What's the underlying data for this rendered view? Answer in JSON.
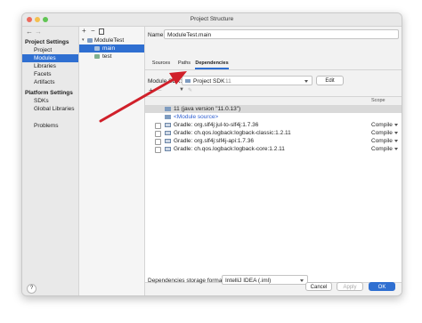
{
  "window": {
    "title": "Project Structure"
  },
  "nav": {
    "project_settings_header": "Project Settings",
    "project_settings_items": [
      "Project",
      "Modules",
      "Libraries",
      "Facets",
      "Artifacts"
    ],
    "platform_settings_header": "Platform Settings",
    "platform_settings_items": [
      "SDKs",
      "Global Libraries"
    ],
    "problems": "Problems"
  },
  "tree": {
    "root": "ModuleTest",
    "children": [
      "main",
      "test"
    ]
  },
  "details": {
    "name_label": "Name:",
    "name_value": "ModuleTest.main",
    "tabs": [
      "Sources",
      "Paths",
      "Dependencies"
    ],
    "module_sdk_label": "Module SDK:",
    "module_sdk_value": "Project SDK",
    "module_sdk_version": "11",
    "edit_button": "Edit",
    "scope_header": "Scope",
    "jdk_row": "11 (java version \"11.0.13\")",
    "module_source_row": "<Module source>",
    "dependencies": [
      {
        "name": "Gradle: org.slf4j:jul-to-slf4j:1.7.36",
        "scope": "Compile"
      },
      {
        "name": "Gradle: ch.qos.logback:logback-classic:1.2.11",
        "scope": "Compile"
      },
      {
        "name": "Gradle: org.slf4j:slf4j-api:1.7.36",
        "scope": "Compile"
      },
      {
        "name": "Gradle: ch.qos.logback:logback-core:1.2.11",
        "scope": "Compile"
      }
    ],
    "storage_label": "Dependencies storage format:",
    "storage_value": "IntelliJ IDEA (.iml)"
  },
  "footer": {
    "cancel": "Cancel",
    "apply": "Apply",
    "ok": "OK",
    "help": "?"
  },
  "colors": {
    "accent": "#2f6fd1",
    "arrow": "#d0202a",
    "link": "#2f5fd0"
  }
}
